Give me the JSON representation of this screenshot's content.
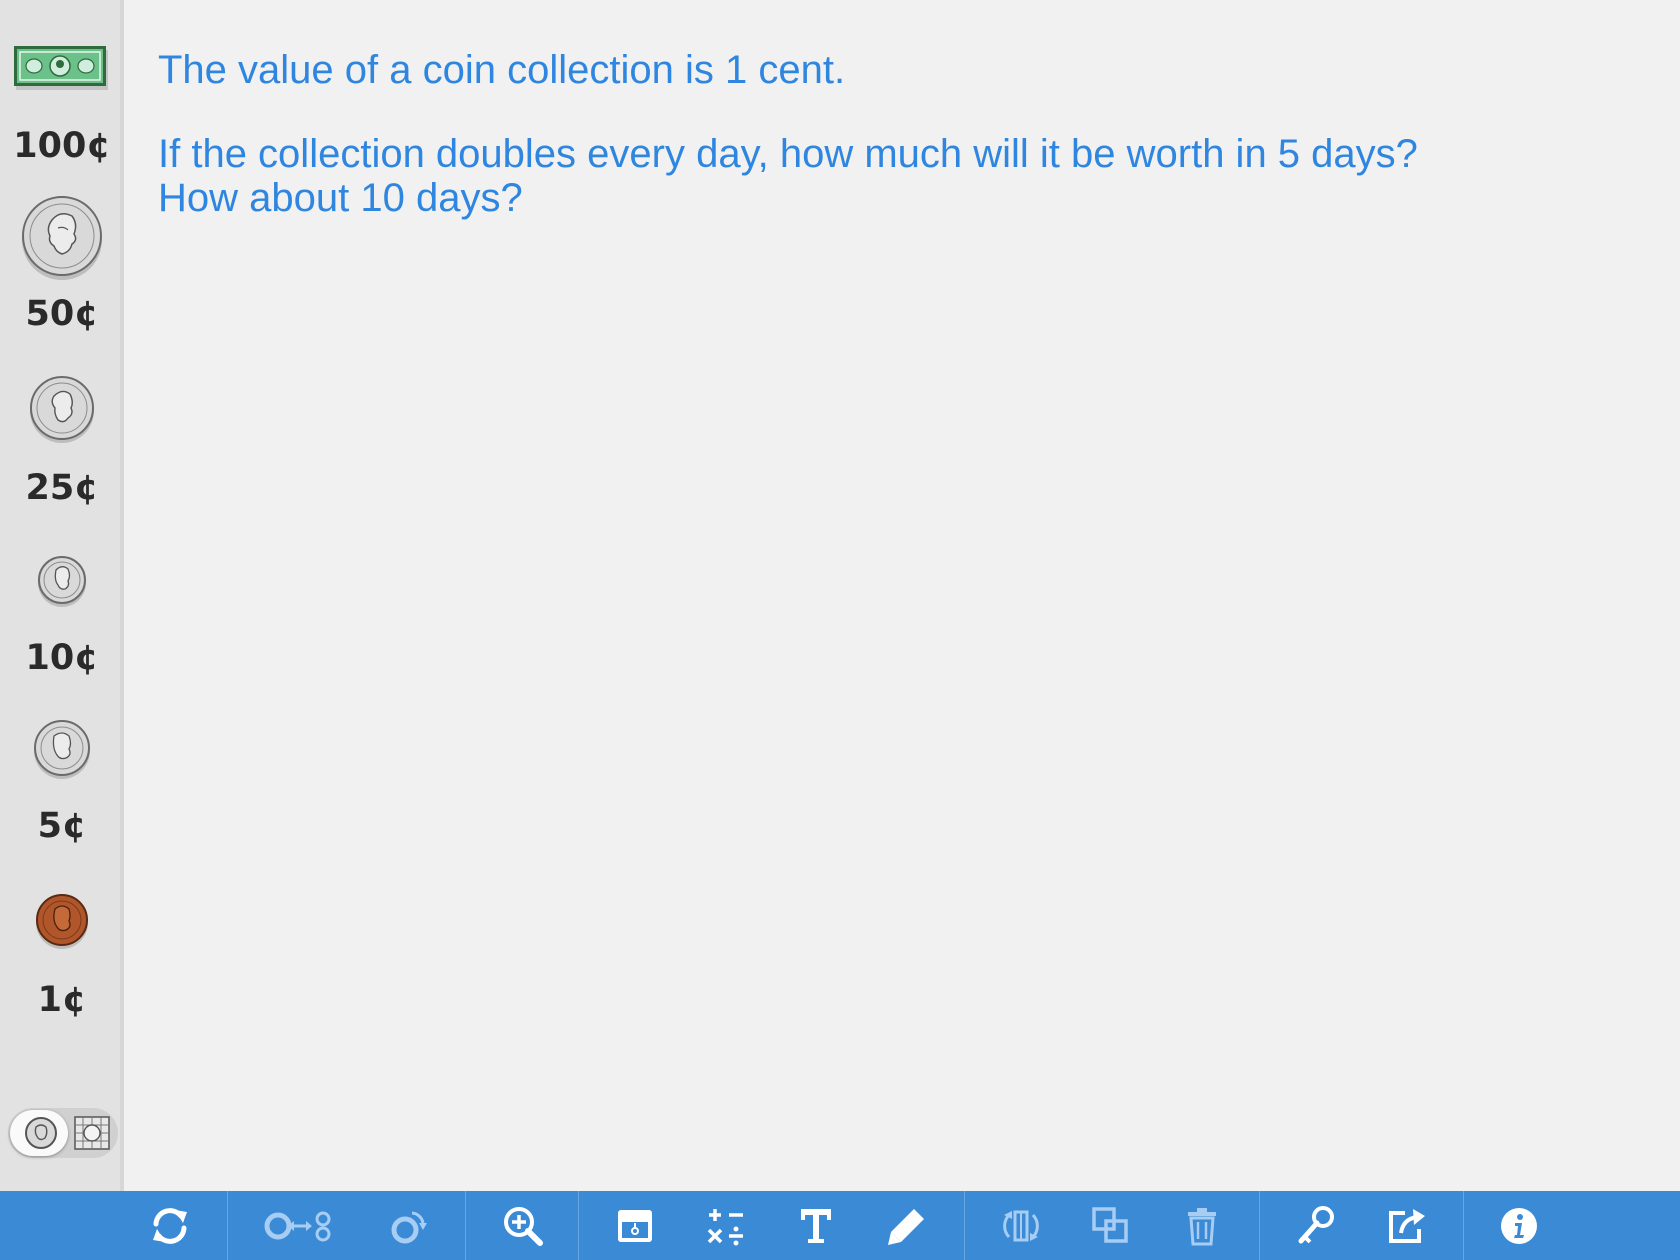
{
  "sidebar": {
    "items": [
      {
        "label": "100¢",
        "icon": "dollar-bill-icon"
      },
      {
        "label": "50¢",
        "icon": "half-dollar-coin-icon"
      },
      {
        "label": "25¢",
        "icon": "quarter-coin-icon"
      },
      {
        "label": "10¢",
        "icon": "dime-coin-icon"
      },
      {
        "label": "5¢",
        "icon": "nickel-coin-icon"
      },
      {
        "label": "1¢",
        "icon": "penny-coin-icon"
      }
    ],
    "toggle": {
      "left_icon": "coin-icon",
      "right_icon": "bill-grid-icon",
      "selected": "coin"
    }
  },
  "problem": {
    "line1": "The value of a coin collection is 1 cent.",
    "line2": "If the collection doubles every day, how much will it be worth in 5 days?",
    "line3": "How about 10 days?"
  },
  "toolbar": {
    "tools": [
      "refresh-icon",
      "exchange-coins-icon",
      "flip-coin-icon",
      "zoom-in-icon",
      "hide-values-icon",
      "math-operations-icon",
      "text-tool-icon",
      "pencil-icon",
      "rotate-icon",
      "bring-to-front-icon",
      "trash-icon",
      "key-icon",
      "share-icon",
      "info-icon"
    ]
  },
  "colors": {
    "prompt_text": "#2f86e0",
    "toolbar_bg": "#3a8ad6",
    "sidebar_bg": "#e2e2e2",
    "canvas_bg": "#f0f1f0",
    "bill_green": "#3f9a5a",
    "penny_copper": "#b0562a"
  }
}
